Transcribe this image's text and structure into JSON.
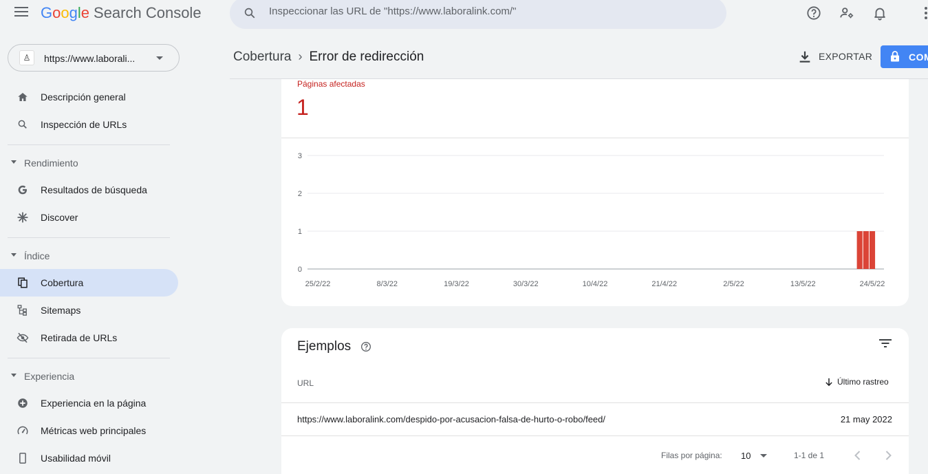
{
  "header": {
    "logo_google": "Google",
    "logo_product": "Search Console",
    "search_placeholder": "Inspeccionar las URL de \"https://www.laboralink.com/\""
  },
  "property": {
    "label": "https://www.laborali..."
  },
  "sidebar": {
    "overview": "Descripción general",
    "url_inspection": "Inspección de URLs",
    "section_performance": "Rendimiento",
    "search_results": "Resultados de búsqueda",
    "discover": "Discover",
    "section_index": "Índice",
    "coverage": "Cobertura",
    "sitemaps": "Sitemaps",
    "removals": "Retirada de URLs",
    "section_experience": "Experiencia",
    "page_experience": "Experiencia en la página",
    "core_web_vitals": "Métricas web principales",
    "mobile_usability": "Usabilidad móvil"
  },
  "page": {
    "breadcrumb_parent": "Cobertura",
    "breadcrumb_current": "Error de redirección",
    "export_label": "EXPORTAR",
    "primary_button_label": "COM"
  },
  "summary": {
    "metric_label": "Páginas afectadas",
    "metric_value": "1"
  },
  "chart_data": {
    "type": "bar",
    "x_tick_labels": [
      "25/2/22",
      "8/3/22",
      "19/3/22",
      "30/3/22",
      "10/4/22",
      "21/4/22",
      "2/5/22",
      "13/5/22",
      "24/5/22"
    ],
    "y_ticks": [
      0,
      1,
      2,
      3
    ],
    "ylim": [
      0,
      3
    ],
    "series": [
      {
        "color": "#db4437",
        "points": [
          {
            "x": "22/5/22",
            "y": 1
          },
          {
            "x": "23/5/22",
            "y": 1
          },
          {
            "x": "24/5/22",
            "y": 1
          }
        ]
      }
    ],
    "grid": true
  },
  "examples": {
    "title": "Ejemplos",
    "col_url": "URL",
    "col_last_crawl": "Último rastreo",
    "rows": [
      {
        "url": "https://www.laboralink.com/despido-por-acusacion-falsa-de-hurto-o-robo/feed/",
        "date": "21 may 2022"
      }
    ],
    "rows_per_page_label": "Filas por página:",
    "rows_per_page_value": "10",
    "range_label": "1-1 de 1"
  }
}
